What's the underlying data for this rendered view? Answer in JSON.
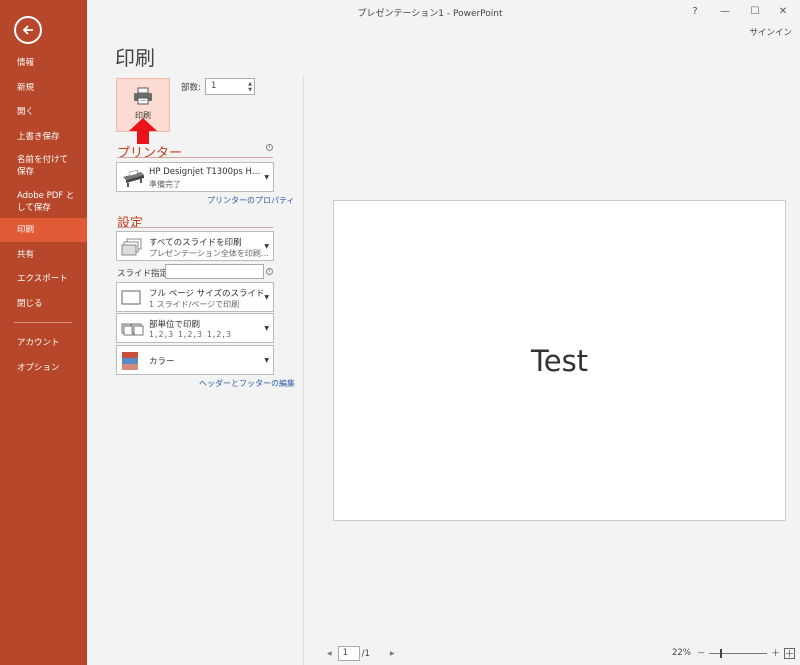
{
  "window": {
    "title": "プレゼンテーション1 - PowerPoint",
    "help": "?",
    "minimize": "—",
    "maximize": "☐",
    "close": "✕",
    "signin": "サインイン"
  },
  "sidebar": {
    "items": [
      {
        "label": "情報"
      },
      {
        "label": "新規"
      },
      {
        "label": "開く"
      },
      {
        "label": "上書き保存"
      },
      {
        "label": "名前を付けて保存"
      },
      {
        "label": "Adobe PDF として保存"
      },
      {
        "label": "印刷",
        "active": true
      },
      {
        "label": "共有"
      },
      {
        "label": "エクスポート"
      },
      {
        "label": "閉じる"
      },
      {
        "label": "アカウント"
      },
      {
        "label": "オプション"
      }
    ]
  },
  "print": {
    "title": "印刷",
    "button_label": "印刷",
    "copies_label": "部数:",
    "copies_value": "1",
    "printer_heading": "プリンター",
    "printer_name": "HP Designjet T1300ps H…",
    "printer_status": "準備完了",
    "printer_properties": "プリンターのプロパティ",
    "settings_heading": "設定",
    "slides_scope_main": "すべてのスライドを印刷",
    "slides_scope_sub": "プレゼンテーション全体を印刷…",
    "slides_label": "スライド指定:",
    "slides_value": "",
    "layout_main": "フル ページ サイズのスライド",
    "layout_sub": "1 スライド/ページで印刷",
    "collate_main": "部単位で印刷",
    "collate_sub": "1,2,3   1,2,3   1,2,3",
    "color_main": "カラー",
    "header_footer_link": "ヘッダーとフッターの編集"
  },
  "preview": {
    "slide_text": "Test"
  },
  "pager": {
    "prev": "◀",
    "current": "1",
    "total": "/1",
    "next": "▶"
  },
  "zoom": {
    "level": "22%",
    "minus": "－",
    "plus": "＋"
  },
  "colors": {
    "sidebar": "#b7472a",
    "sidebar_active": "#e05a36",
    "accent": "#c43e1c",
    "link": "#2a5aa6",
    "arrow": "#e8141a"
  }
}
